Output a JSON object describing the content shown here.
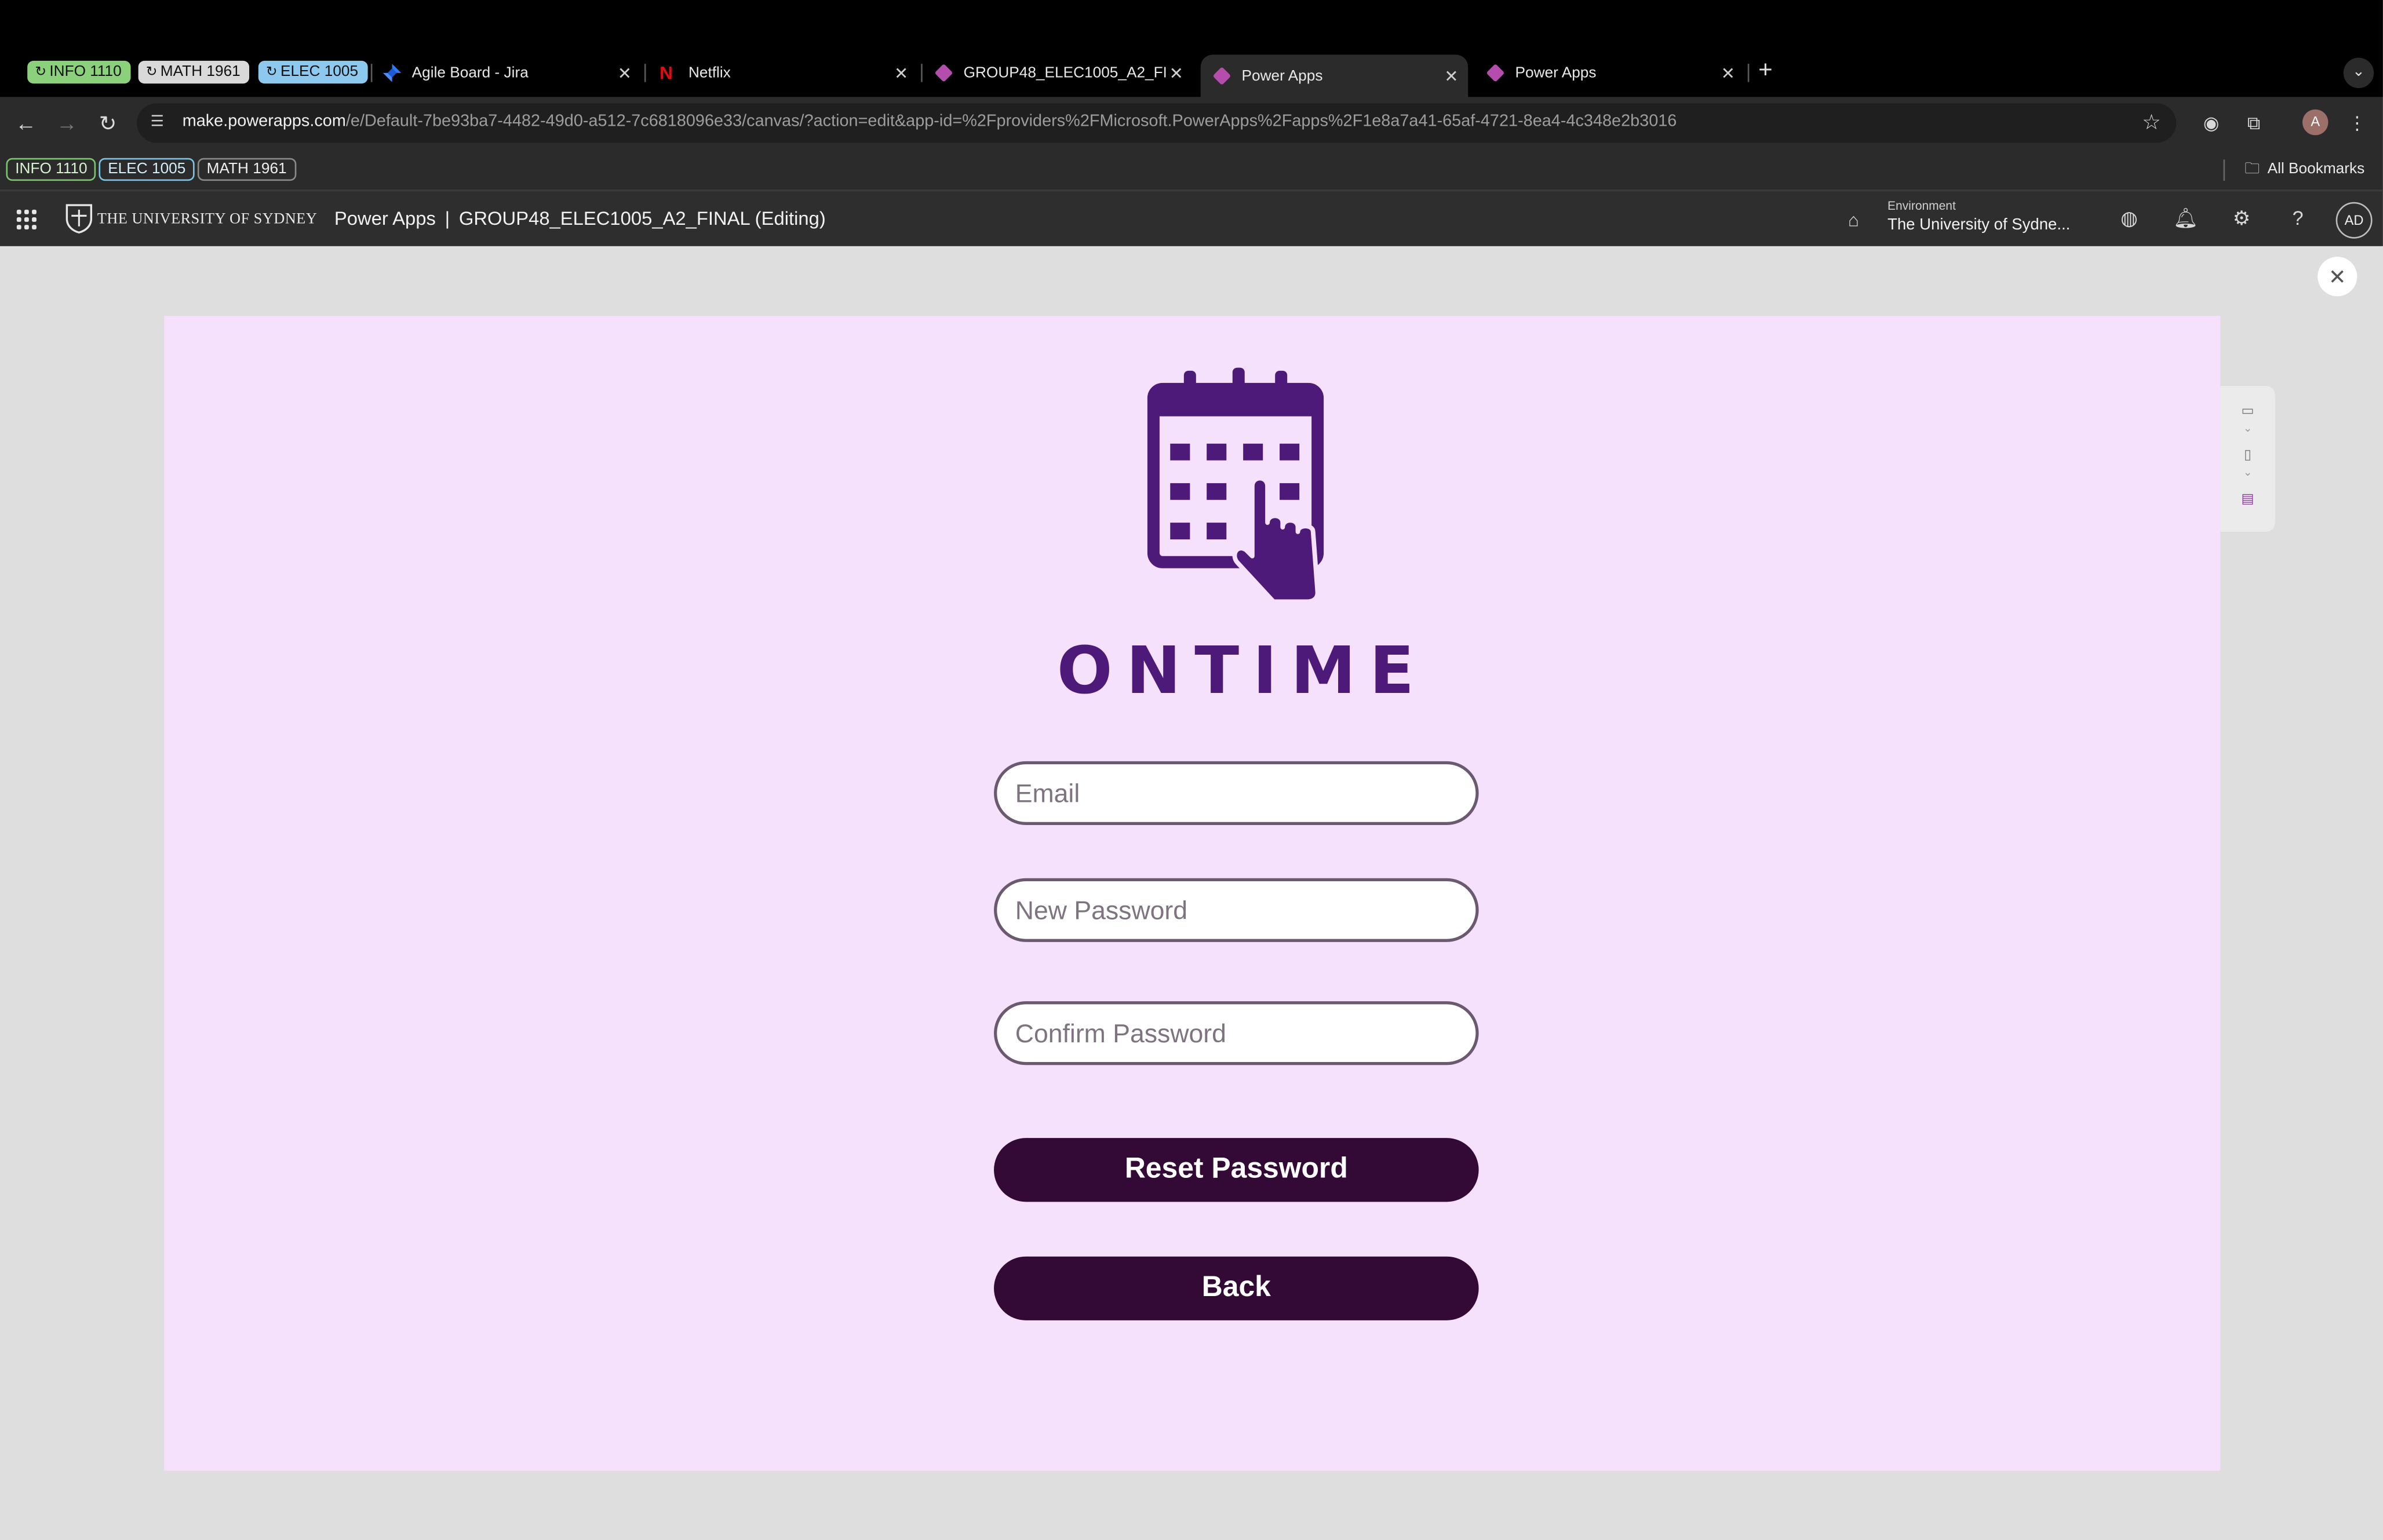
{
  "browser": {
    "tab_groups": [
      {
        "label": "INFO 1110",
        "color": "#8bd17c"
      },
      {
        "label": "MATH 1961",
        "color": "#d9d9d9"
      },
      {
        "label": "ELEC 1005",
        "color": "#8dc9ef"
      }
    ],
    "tabs": [
      {
        "title": "Agile Board - Jira",
        "icon": "jira-icon"
      },
      {
        "title": "Netflix",
        "icon": "netflix-icon"
      },
      {
        "title": "GROUP48_ELEC1005_A2_FINAL",
        "icon": "power-apps-icon"
      },
      {
        "title": "Power Apps",
        "icon": "power-apps-icon",
        "active": true
      },
      {
        "title": "Power Apps",
        "icon": "power-apps-icon"
      }
    ],
    "address": {
      "host": "make.powerapps.com",
      "path": "/e/Default-7be93ba7-4482-49d0-a512-7c6818096e33/canvas/?action=edit&app-id=%2Fproviders%2FMicrosoft.PowerApps%2Fapps%2F1e8a7a41-65af-4721-8ea4-4c348e2b3016"
    },
    "bookmarks": [
      "INFO 1110",
      "ELEC 1005",
      "MATH 1961"
    ],
    "all_bookmarks_label": "All Bookmarks",
    "profile_initial": "A"
  },
  "header": {
    "university": "THE UNIVERSITY OF SYDNEY",
    "product": "Power Apps",
    "separator": "|",
    "app_name": "GROUP48_ELEC1005_A2_FINAL (Editing)",
    "environment_label": "Environment",
    "environment_value": "The University of Sydne...",
    "avatar_initials": "AD"
  },
  "app": {
    "brand": "ONTIME",
    "brand_color": "#4d1a7a",
    "canvas_bg": "#f5e1fb",
    "button_color": "#330a36",
    "fields": {
      "email_placeholder": "Email",
      "new_password_placeholder": "New Password",
      "confirm_password_placeholder": "Confirm Password"
    },
    "buttons": {
      "reset": "Reset Password",
      "back": "Back"
    }
  }
}
